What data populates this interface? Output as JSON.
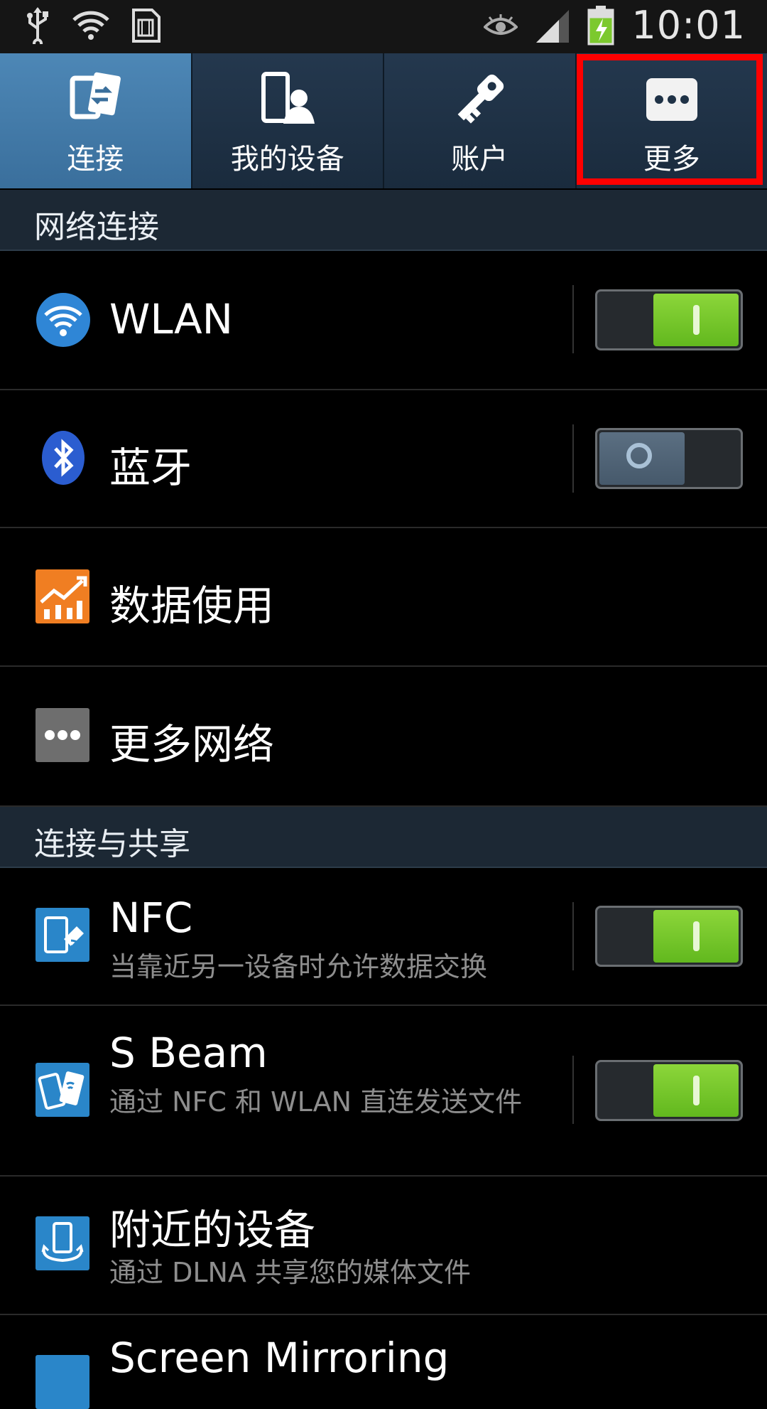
{
  "status_bar": {
    "time": "10:01",
    "icons": [
      "usb-icon",
      "wifi-question-icon",
      "sim-icon",
      "eye-icon",
      "signal-icon",
      "battery-charging-icon"
    ]
  },
  "tabs": [
    {
      "label": "连接",
      "icon": "connections-icon",
      "active": true
    },
    {
      "label": "我的设备",
      "icon": "my-device-icon",
      "active": false
    },
    {
      "label": "账户",
      "icon": "key-icon",
      "active": false
    },
    {
      "label": "更多",
      "icon": "more-icon",
      "active": false
    }
  ],
  "sections": {
    "network": "网络连接",
    "sharing": "连接与共享"
  },
  "rows": {
    "wlan": {
      "title": "WLAN",
      "toggle": "on"
    },
    "bluetooth": {
      "title": "蓝牙",
      "toggle": "off"
    },
    "data_usage": {
      "title": "数据使用"
    },
    "more_networks": {
      "title": "更多网络"
    },
    "nfc": {
      "title": "NFC",
      "subtitle": "当靠近另一设备时允许数据交换",
      "toggle": "on"
    },
    "sbeam": {
      "title": "S Beam",
      "subtitle": "通过 NFC 和 WLAN 直连发送文件",
      "toggle": "on"
    },
    "nearby": {
      "title": "附近的设备",
      "subtitle": "通过 DLNA 共享您的媒体文件"
    },
    "screen_mirroring": {
      "title": "Screen Mirroring"
    }
  },
  "colors": {
    "active_tab": "#4d87b6",
    "toggle_on": "#7cc92e",
    "highlight": "#ff0000",
    "section_bg": "#1c2834"
  }
}
